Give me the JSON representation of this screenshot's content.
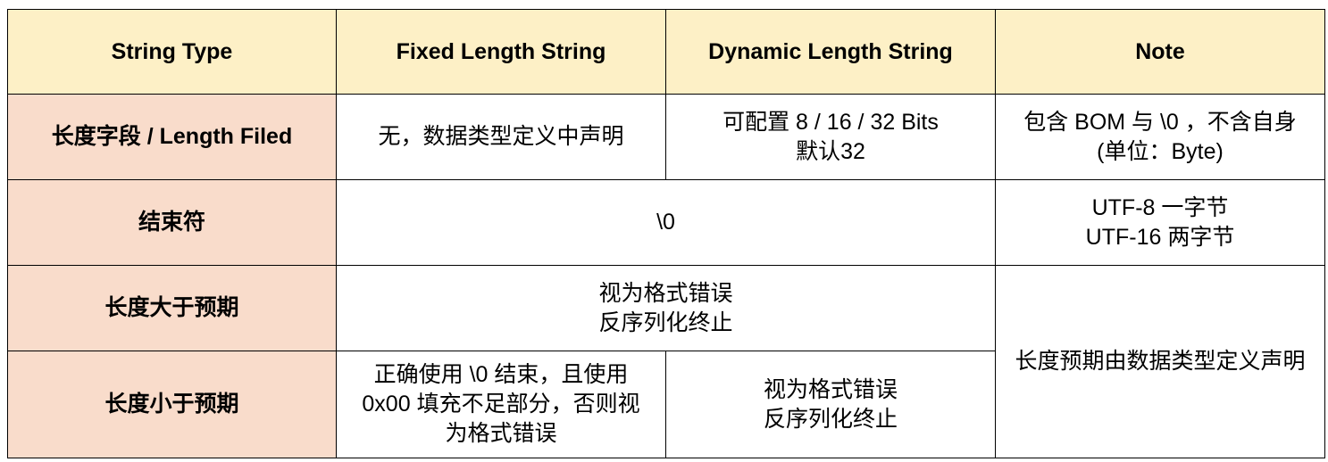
{
  "table": {
    "headers": [
      "String Type",
      "Fixed Length String",
      "Dynamic Length String",
      "Note"
    ],
    "rows": [
      {
        "label": "长度字段 / Length Filed",
        "fixed": "无，数据类型定义中声明",
        "dynamic": [
          "可配置 8 / 16 / 32 Bits",
          "默认32"
        ],
        "note": [
          "包含 BOM 与 \\0 ，不含自身",
          "(单位：Byte)"
        ]
      },
      {
        "label": "结束符",
        "shared": "\\0",
        "note": [
          "UTF-8 一字节",
          "UTF-16 两字节"
        ]
      },
      {
        "label": "长度大于预期",
        "shared": [
          "视为格式错误",
          "反序列化终止"
        ]
      },
      {
        "label": "长度小于预期",
        "fixed": [
          "正确使用 \\0 结束，且使用",
          "0x00 填充不足部分，否则视",
          "为格式错误"
        ],
        "dynamic": [
          "视为格式错误",
          "反序列化终止"
        ]
      }
    ],
    "merged_note": "长度预期由数据类型定义声明"
  },
  "colors": {
    "header_bg": "#fdf0c6",
    "row_label_bg": "#f9dccb",
    "cell_bg": "#ffffff",
    "border": "#000000"
  }
}
